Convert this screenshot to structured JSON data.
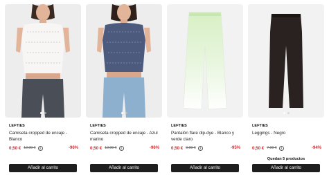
{
  "products": [
    {
      "brand": "LEFTIES",
      "title": "Camiseta cropped de encaje - Blanco",
      "price": "0,50 €",
      "old_price": "12,99 €",
      "discount": "-96%",
      "button": "Añadir al carrito",
      "stock": ""
    },
    {
      "brand": "LEFTIES",
      "title": "Camiseta cropped de encaje - Azul marino",
      "price": "0,50 €",
      "old_price": "12,99 €",
      "discount": "-96%",
      "button": "Añadir al carrito",
      "stock": ""
    },
    {
      "brand": "LEFTIES",
      "title": "Pantalón flare dip-dye - Blanco y verde claro",
      "price": "0,50 €",
      "old_price": "9,99 €",
      "discount": "-95%",
      "button": "Añadir al carrito",
      "stock": ""
    },
    {
      "brand": "LEFTIES",
      "title": "Leggings - Negro",
      "price": "0,50 €",
      "old_price": "7,99 €",
      "discount": "-94%",
      "button": "Añadir al carrito",
      "stock": "Quedan 5 productos"
    }
  ],
  "icons": {
    "info": "info-icon"
  },
  "colors": {
    "price": "#d1272c",
    "button_bg": "#1e1e1e"
  }
}
